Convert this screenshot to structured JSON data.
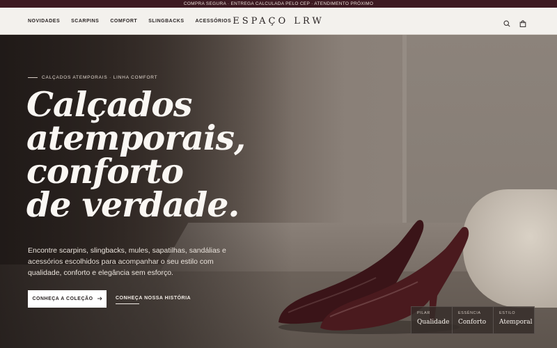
{
  "announcement": "COMPRA SEGURA · ENTREGA CALCULADA PELO CEP · ATENDIMENTO PRÓXIMO",
  "nav": [
    "NOVIDADES",
    "SCARPINS",
    "COMFORT",
    "SLINGBACKS",
    "ACESSÓRIOS"
  ],
  "brand": "ESPAÇO LRW",
  "header_icons": [
    "search-icon",
    "shopping-bag-icon"
  ],
  "hero": {
    "eyebrow": "CALÇADOS ATEMPORAIS · LINHA COMFORT",
    "headline": [
      "Calçados",
      "atemporais,",
      "conforto",
      "de verdade."
    ],
    "lede": "Encontre scarpins, slingbacks, mules, sapatilhas, sandálias e acessórios escolhidos para acompanhar o seu estilo com qualidade, conforto e elegância sem esforço.",
    "cta_primary": "CONHEÇA A COLEÇÃO",
    "cta_primary_icon": "arrow-right-icon",
    "cta_secondary": "CONHEÇA NOSSA HISTÓRIA"
  },
  "badges": [
    {
      "key": "PILAR",
      "value": "Qualidade"
    },
    {
      "key": "ESSÊNCIA",
      "value": "Conforto"
    },
    {
      "key": "ESTILO",
      "value": "Atemporal"
    }
  ],
  "colors": {
    "announcement_bg": "#3d1a22",
    "header_bg": "#f3f1ed",
    "shoe": "#4a1a1e",
    "text_dark": "#2a2424"
  }
}
